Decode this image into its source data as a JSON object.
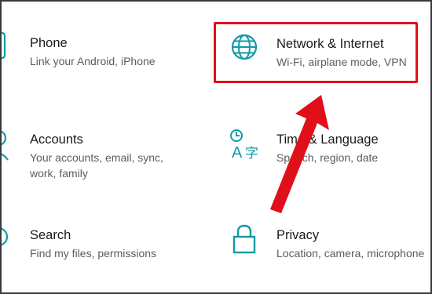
{
  "tiles": {
    "phone": {
      "title": "Phone",
      "desc": "Link your Android, iPhone",
      "icon": "phone-icon"
    },
    "network": {
      "title": "Network & Internet",
      "desc": "Wi-Fi, airplane mode, VPN",
      "icon": "globe-icon"
    },
    "accounts": {
      "title": "Accounts",
      "desc": "Your accounts, email, sync, work, family",
      "icon": "person-icon"
    },
    "time": {
      "title": "Time & Language",
      "desc": "Speech, region, date",
      "icon": "language-icon"
    },
    "search": {
      "title": "Search",
      "desc": "Find my files, permissions",
      "icon": "search-icon"
    },
    "privacy": {
      "title": "Privacy",
      "desc": "Location, camera, microphone",
      "icon": "lock-icon"
    }
  },
  "annotation": {
    "highlight_color": "#e0101a",
    "arrow_color": "#e0101a"
  },
  "colors": {
    "accent": "#0f9ba8",
    "title": "#1a1a1a",
    "desc": "#5c5c5c"
  }
}
